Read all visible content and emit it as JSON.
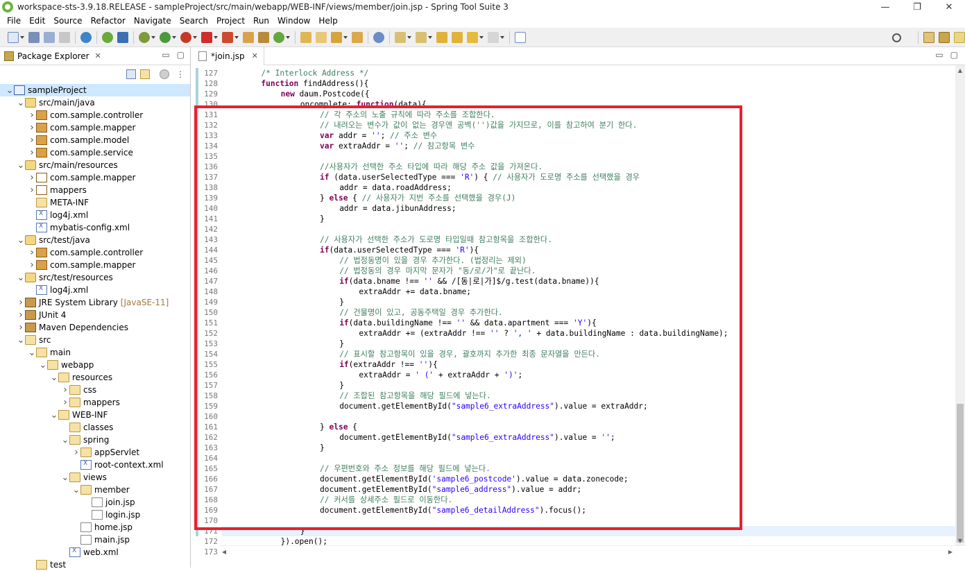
{
  "window": {
    "title": "workspace-sts-3.9.18.RELEASE - sampleProject/src/main/webapp/WEB-INF/views/member/join.jsp - Spring Tool Suite 3",
    "minimize": "—",
    "maximize": "❐",
    "close": "✕"
  },
  "menu": [
    "File",
    "Edit",
    "Source",
    "Refactor",
    "Navigate",
    "Search",
    "Project",
    "Run",
    "Window",
    "Help"
  ],
  "package_explorer": {
    "tab_label": "Package Explorer",
    "close_glyph": "✕",
    "tree": [
      {
        "label": "sampleProject",
        "depth": 0,
        "icon": "project",
        "open": true,
        "selected": true
      },
      {
        "label": "src/main/java",
        "depth": 1,
        "icon": "srcfolder",
        "open": true
      },
      {
        "label": "com.sample.controller",
        "depth": 2,
        "icon": "pkg",
        "open": false
      },
      {
        "label": "com.sample.mapper",
        "depth": 2,
        "icon": "pkg",
        "open": false
      },
      {
        "label": "com.sample.model",
        "depth": 2,
        "icon": "pkg",
        "open": false
      },
      {
        "label": "com.sample.service",
        "depth": 2,
        "icon": "pkg",
        "open": false
      },
      {
        "label": "src/main/resources",
        "depth": 1,
        "icon": "srcfolder",
        "open": true
      },
      {
        "label": "com.sample.mapper",
        "depth": 2,
        "icon": "pkgempty",
        "open": false
      },
      {
        "label": "mappers",
        "depth": 2,
        "icon": "pkgempty",
        "open": false
      },
      {
        "label": "META-INF",
        "depth": 2,
        "icon": "folder",
        "leaf": true
      },
      {
        "label": "log4j.xml",
        "depth": 2,
        "icon": "xml",
        "leaf": true
      },
      {
        "label": "mybatis-config.xml",
        "depth": 2,
        "icon": "xml",
        "leaf": true
      },
      {
        "label": "src/test/java",
        "depth": 1,
        "icon": "srcfolder",
        "open": true
      },
      {
        "label": "com.sample.controller",
        "depth": 2,
        "icon": "pkg",
        "open": false
      },
      {
        "label": "com.sample.mapper",
        "depth": 2,
        "icon": "pkg",
        "open": false
      },
      {
        "label": "src/test/resources",
        "depth": 1,
        "icon": "srcfolder",
        "open": true
      },
      {
        "label": "log4j.xml",
        "depth": 2,
        "icon": "xml",
        "leaf": true
      },
      {
        "label": "JRE System Library",
        "decor": "[JavaSE-11]",
        "depth": 1,
        "icon": "lib",
        "open": false
      },
      {
        "label": "JUnit 4",
        "depth": 1,
        "icon": "lib",
        "open": false
      },
      {
        "label": "Maven Dependencies",
        "depth": 1,
        "icon": "lib",
        "open": false
      },
      {
        "label": "src",
        "depth": 1,
        "icon": "folder",
        "open": true
      },
      {
        "label": "main",
        "depth": 2,
        "icon": "folder",
        "open": true
      },
      {
        "label": "webapp",
        "depth": 3,
        "icon": "folder",
        "open": true
      },
      {
        "label": "resources",
        "depth": 4,
        "icon": "folder",
        "open": true
      },
      {
        "label": "css",
        "depth": 5,
        "icon": "folder",
        "open": false
      },
      {
        "label": "mappers",
        "depth": 5,
        "icon": "folder",
        "open": false
      },
      {
        "label": "WEB-INF",
        "depth": 4,
        "icon": "folder",
        "open": true
      },
      {
        "label": "classes",
        "depth": 5,
        "icon": "folder",
        "leaf": true
      },
      {
        "label": "spring",
        "depth": 5,
        "icon": "folder",
        "open": true
      },
      {
        "label": "appServlet",
        "depth": 6,
        "icon": "folder",
        "open": false
      },
      {
        "label": "root-context.xml",
        "depth": 6,
        "icon": "xml",
        "leaf": true
      },
      {
        "label": "views",
        "depth": 5,
        "icon": "folder",
        "open": true
      },
      {
        "label": "member",
        "depth": 6,
        "icon": "folder",
        "open": true
      },
      {
        "label": "join.jsp",
        "depth": 7,
        "icon": "jsp",
        "leaf": true
      },
      {
        "label": "login.jsp",
        "depth": 7,
        "icon": "jsp",
        "leaf": true
      },
      {
        "label": "home.jsp",
        "depth": 6,
        "icon": "jsp",
        "leaf": true
      },
      {
        "label": "main.jsp",
        "depth": 6,
        "icon": "jsp",
        "leaf": true
      },
      {
        "label": "web.xml",
        "depth": 5,
        "icon": "xml",
        "leaf": true
      },
      {
        "label": "test",
        "depth": 2,
        "icon": "folder",
        "leaf": true
      }
    ]
  },
  "editor": {
    "tab_label": "*join.jsp",
    "close_glyph": "✕",
    "current_line": 171,
    "lines": [
      {
        "n": 127,
        "i": 2,
        "t": [
          [
            "cm",
            "/* Interlock Address */"
          ]
        ]
      },
      {
        "n": 128,
        "i": 2,
        "t": [
          [
            "kw",
            "function"
          ],
          [
            "",
            " findAddress(){"
          ]
        ]
      },
      {
        "n": 129,
        "i": 3,
        "t": [
          [
            "kw",
            "new"
          ],
          [
            "",
            " daum.Postcode({"
          ]
        ]
      },
      {
        "n": 130,
        "i": 4,
        "t": [
          [
            "",
            "oncomplete: "
          ],
          [
            "kw",
            "function"
          ],
          [
            "",
            "(data){"
          ]
        ]
      },
      {
        "n": 131,
        "i": 5,
        "t": [
          [
            "cm",
            "// 각 주소의 노출 규칙에 따라 주소를 조합한다."
          ]
        ]
      },
      {
        "n": 132,
        "i": 5,
        "t": [
          [
            "cm",
            "// 내려오는 변수가 값이 없는 경우엔 공백('')값을 가지므로, 이를 참고하여 분기 한다."
          ]
        ]
      },
      {
        "n": 133,
        "i": 5,
        "t": [
          [
            "kw",
            "var"
          ],
          [
            "",
            " addr = "
          ],
          [
            "st",
            "''"
          ],
          [
            "",
            "; "
          ],
          [
            "cm",
            "// 주소 변수"
          ]
        ]
      },
      {
        "n": 134,
        "i": 5,
        "t": [
          [
            "kw",
            "var"
          ],
          [
            "",
            " extraAddr = "
          ],
          [
            "st",
            "''"
          ],
          [
            "",
            "; "
          ],
          [
            "cm",
            "// 참고항목 변수"
          ]
        ]
      },
      {
        "n": 135,
        "i": 0,
        "t": []
      },
      {
        "n": 136,
        "i": 5,
        "t": [
          [
            "cm",
            "//사용자가 선택한 주소 타입에 따라 해당 주소 값을 가져온다."
          ]
        ]
      },
      {
        "n": 137,
        "i": 5,
        "t": [
          [
            "kw",
            "if"
          ],
          [
            "",
            " (data.userSelectedType === "
          ],
          [
            "st",
            "'R'"
          ],
          [
            "",
            ") { "
          ],
          [
            "cm",
            "// 사용자가 도로명 주소를 선택했을 경우"
          ]
        ]
      },
      {
        "n": 138,
        "i": 6,
        "t": [
          [
            "",
            "addr = data.roadAddress;"
          ]
        ]
      },
      {
        "n": 139,
        "i": 5,
        "t": [
          [
            "",
            "} "
          ],
          [
            "kw",
            "else"
          ],
          [
            "",
            " { "
          ],
          [
            "cm",
            "// 사용자가 지번 주소를 선택했을 경우(J)"
          ]
        ]
      },
      {
        "n": 140,
        "i": 6,
        "t": [
          [
            "",
            "addr = data.jibunAddress;"
          ]
        ]
      },
      {
        "n": 141,
        "i": 5,
        "t": [
          [
            "",
            "}"
          ]
        ]
      },
      {
        "n": 142,
        "i": 0,
        "t": []
      },
      {
        "n": 143,
        "i": 5,
        "t": [
          [
            "cm",
            "// 사용자가 선택한 주소가 도로명 타입일때 참고항목을 조합한다."
          ]
        ]
      },
      {
        "n": 144,
        "i": 5,
        "t": [
          [
            "kw",
            "if"
          ],
          [
            "",
            "(data.userSelectedType === "
          ],
          [
            "st",
            "'R'"
          ],
          [
            "",
            "){"
          ]
        ]
      },
      {
        "n": 145,
        "i": 6,
        "t": [
          [
            "cm",
            "// 법정동명이 있을 경우 추가한다. (법정리는 제외)"
          ]
        ]
      },
      {
        "n": 146,
        "i": 6,
        "t": [
          [
            "cm",
            "// 법정동의 경우 마지막 문자가 \"동/로/가\"로 끝난다."
          ]
        ]
      },
      {
        "n": 147,
        "i": 6,
        "t": [
          [
            "kw",
            "if"
          ],
          [
            "",
            "(data.bname !== "
          ],
          [
            "st",
            "''"
          ],
          [
            "",
            " && /[동|로|가]$/g.test(data.bname)){"
          ]
        ]
      },
      {
        "n": 148,
        "i": 7,
        "t": [
          [
            "",
            "extraAddr += data.bname;"
          ]
        ]
      },
      {
        "n": 149,
        "i": 6,
        "t": [
          [
            "",
            "}"
          ]
        ]
      },
      {
        "n": 150,
        "i": 6,
        "t": [
          [
            "cm",
            "// 건물명이 있고, 공동주택일 경우 추가한다."
          ]
        ]
      },
      {
        "n": 151,
        "i": 6,
        "t": [
          [
            "kw",
            "if"
          ],
          [
            "",
            "(data.buildingName !== "
          ],
          [
            "st",
            "''"
          ],
          [
            "",
            " && data.apartment === "
          ],
          [
            "st",
            "'Y'"
          ],
          [
            "",
            "){"
          ]
        ]
      },
      {
        "n": 152,
        "i": 7,
        "t": [
          [
            "",
            "extraAddr += (extraAddr !== "
          ],
          [
            "st",
            "''"
          ],
          [
            "",
            " ? "
          ],
          [
            "st",
            "', '"
          ],
          [
            "",
            " + data.buildingName : data.buildingName);"
          ]
        ]
      },
      {
        "n": 153,
        "i": 6,
        "t": [
          [
            "",
            "}"
          ]
        ]
      },
      {
        "n": 154,
        "i": 6,
        "t": [
          [
            "cm",
            "// 표시할 참고항목이 있을 경우, 괄호까지 추가한 최종 문자열을 만든다."
          ]
        ]
      },
      {
        "n": 155,
        "i": 6,
        "t": [
          [
            "kw",
            "if"
          ],
          [
            "",
            "(extraAddr !== "
          ],
          [
            "st",
            "''"
          ],
          [
            "",
            "){"
          ]
        ]
      },
      {
        "n": 156,
        "i": 7,
        "t": [
          [
            "",
            "extraAddr = "
          ],
          [
            "st",
            "' ('"
          ],
          [
            "",
            " + extraAddr + "
          ],
          [
            "st",
            "')'"
          ],
          [
            "",
            ";"
          ]
        ]
      },
      {
        "n": 157,
        "i": 6,
        "t": [
          [
            "",
            "}"
          ]
        ]
      },
      {
        "n": 158,
        "i": 6,
        "t": [
          [
            "cm",
            "// 조합된 참고항목을 해당 필드에 넣는다."
          ]
        ]
      },
      {
        "n": 159,
        "i": 6,
        "t": [
          [
            "",
            "document.getElementById("
          ],
          [
            "st",
            "\"sample6_extraAddress\""
          ],
          [
            "",
            ").value = extraAddr;"
          ]
        ]
      },
      {
        "n": 160,
        "i": 0,
        "t": []
      },
      {
        "n": 161,
        "i": 5,
        "t": [
          [
            "",
            "} "
          ],
          [
            "kw",
            "else"
          ],
          [
            "",
            " {"
          ]
        ]
      },
      {
        "n": 162,
        "i": 6,
        "t": [
          [
            "",
            "document.getElementById("
          ],
          [
            "st",
            "\"sample6_extraAddress\""
          ],
          [
            "",
            ").value = "
          ],
          [
            "st",
            "''"
          ],
          [
            "",
            ";"
          ]
        ]
      },
      {
        "n": 163,
        "i": 5,
        "t": [
          [
            "",
            "}"
          ]
        ]
      },
      {
        "n": 164,
        "i": 0,
        "t": []
      },
      {
        "n": 165,
        "i": 5,
        "t": [
          [
            "cm",
            "// 우편번호와 주소 정보를 해당 필드에 넣는다."
          ]
        ]
      },
      {
        "n": 166,
        "i": 5,
        "t": [
          [
            "",
            "document.getElementById("
          ],
          [
            "st",
            "'sample6_postcode'"
          ],
          [
            "",
            ").value = data.zonecode;"
          ]
        ]
      },
      {
        "n": 167,
        "i": 5,
        "t": [
          [
            "",
            "document.getElementById("
          ],
          [
            "st",
            "\"sample6_address\""
          ],
          [
            "",
            ").value = addr;"
          ]
        ]
      },
      {
        "n": 168,
        "i": 5,
        "t": [
          [
            "cm",
            "// 커서를 상세주소 필드로 이동한다."
          ]
        ]
      },
      {
        "n": 169,
        "i": 5,
        "t": [
          [
            "",
            "document.getElementById("
          ],
          [
            "st",
            "\"sample6_detailAddress\""
          ],
          [
            "",
            ").focus();"
          ]
        ]
      },
      {
        "n": 170,
        "i": 0,
        "t": []
      },
      {
        "n": 171,
        "i": 4,
        "t": [
          [
            "",
            "}"
          ]
        ]
      },
      {
        "n": 172,
        "i": 3,
        "t": [
          [
            "",
            "}).open();"
          ]
        ]
      },
      {
        "n": 173,
        "i": 2,
        "t": [
          [
            "",
            "}"
          ]
        ]
      }
    ]
  },
  "colors": {
    "highlight_box": "#e8202e",
    "keyword": "#7f0055",
    "comment": "#3f7f5f",
    "string": "#2a00ff"
  }
}
